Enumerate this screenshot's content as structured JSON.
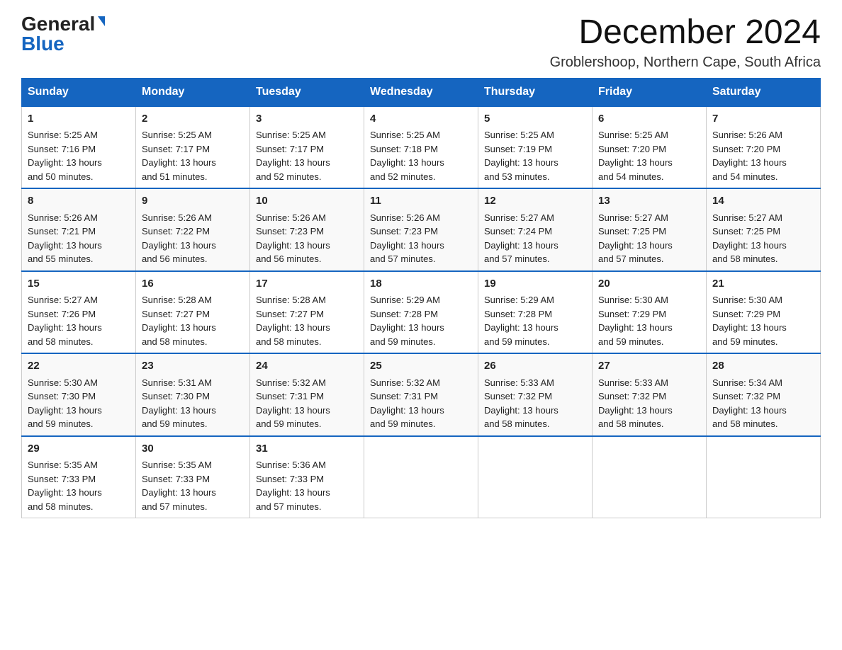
{
  "logo": {
    "general": "General",
    "blue": "Blue"
  },
  "title": "December 2024",
  "subtitle": "Groblershoop, Northern Cape, South Africa",
  "days": [
    "Sunday",
    "Monday",
    "Tuesday",
    "Wednesday",
    "Thursday",
    "Friday",
    "Saturday"
  ],
  "weeks": [
    [
      {
        "date": "1",
        "sunrise": "5:25 AM",
        "sunset": "7:16 PM",
        "daylight": "13 hours and 50 minutes."
      },
      {
        "date": "2",
        "sunrise": "5:25 AM",
        "sunset": "7:17 PM",
        "daylight": "13 hours and 51 minutes."
      },
      {
        "date": "3",
        "sunrise": "5:25 AM",
        "sunset": "7:17 PM",
        "daylight": "13 hours and 52 minutes."
      },
      {
        "date": "4",
        "sunrise": "5:25 AM",
        "sunset": "7:18 PM",
        "daylight": "13 hours and 52 minutes."
      },
      {
        "date": "5",
        "sunrise": "5:25 AM",
        "sunset": "7:19 PM",
        "daylight": "13 hours and 53 minutes."
      },
      {
        "date": "6",
        "sunrise": "5:25 AM",
        "sunset": "7:20 PM",
        "daylight": "13 hours and 54 minutes."
      },
      {
        "date": "7",
        "sunrise": "5:26 AM",
        "sunset": "7:20 PM",
        "daylight": "13 hours and 54 minutes."
      }
    ],
    [
      {
        "date": "8",
        "sunrise": "5:26 AM",
        "sunset": "7:21 PM",
        "daylight": "13 hours and 55 minutes."
      },
      {
        "date": "9",
        "sunrise": "5:26 AM",
        "sunset": "7:22 PM",
        "daylight": "13 hours and 56 minutes."
      },
      {
        "date": "10",
        "sunrise": "5:26 AM",
        "sunset": "7:23 PM",
        "daylight": "13 hours and 56 minutes."
      },
      {
        "date": "11",
        "sunrise": "5:26 AM",
        "sunset": "7:23 PM",
        "daylight": "13 hours and 57 minutes."
      },
      {
        "date": "12",
        "sunrise": "5:27 AM",
        "sunset": "7:24 PM",
        "daylight": "13 hours and 57 minutes."
      },
      {
        "date": "13",
        "sunrise": "5:27 AM",
        "sunset": "7:25 PM",
        "daylight": "13 hours and 57 minutes."
      },
      {
        "date": "14",
        "sunrise": "5:27 AM",
        "sunset": "7:25 PM",
        "daylight": "13 hours and 58 minutes."
      }
    ],
    [
      {
        "date": "15",
        "sunrise": "5:27 AM",
        "sunset": "7:26 PM",
        "daylight": "13 hours and 58 minutes."
      },
      {
        "date": "16",
        "sunrise": "5:28 AM",
        "sunset": "7:27 PM",
        "daylight": "13 hours and 58 minutes."
      },
      {
        "date": "17",
        "sunrise": "5:28 AM",
        "sunset": "7:27 PM",
        "daylight": "13 hours and 58 minutes."
      },
      {
        "date": "18",
        "sunrise": "5:29 AM",
        "sunset": "7:28 PM",
        "daylight": "13 hours and 59 minutes."
      },
      {
        "date": "19",
        "sunrise": "5:29 AM",
        "sunset": "7:28 PM",
        "daylight": "13 hours and 59 minutes."
      },
      {
        "date": "20",
        "sunrise": "5:30 AM",
        "sunset": "7:29 PM",
        "daylight": "13 hours and 59 minutes."
      },
      {
        "date": "21",
        "sunrise": "5:30 AM",
        "sunset": "7:29 PM",
        "daylight": "13 hours and 59 minutes."
      }
    ],
    [
      {
        "date": "22",
        "sunrise": "5:30 AM",
        "sunset": "7:30 PM",
        "daylight": "13 hours and 59 minutes."
      },
      {
        "date": "23",
        "sunrise": "5:31 AM",
        "sunset": "7:30 PM",
        "daylight": "13 hours and 59 minutes."
      },
      {
        "date": "24",
        "sunrise": "5:32 AM",
        "sunset": "7:31 PM",
        "daylight": "13 hours and 59 minutes."
      },
      {
        "date": "25",
        "sunrise": "5:32 AM",
        "sunset": "7:31 PM",
        "daylight": "13 hours and 59 minutes."
      },
      {
        "date": "26",
        "sunrise": "5:33 AM",
        "sunset": "7:32 PM",
        "daylight": "13 hours and 58 minutes."
      },
      {
        "date": "27",
        "sunrise": "5:33 AM",
        "sunset": "7:32 PM",
        "daylight": "13 hours and 58 minutes."
      },
      {
        "date": "28",
        "sunrise": "5:34 AM",
        "sunset": "7:32 PM",
        "daylight": "13 hours and 58 minutes."
      }
    ],
    [
      {
        "date": "29",
        "sunrise": "5:35 AM",
        "sunset": "7:33 PM",
        "daylight": "13 hours and 58 minutes."
      },
      {
        "date": "30",
        "sunrise": "5:35 AM",
        "sunset": "7:33 PM",
        "daylight": "13 hours and 57 minutes."
      },
      {
        "date": "31",
        "sunrise": "5:36 AM",
        "sunset": "7:33 PM",
        "daylight": "13 hours and 57 minutes."
      },
      null,
      null,
      null,
      null
    ]
  ],
  "labels": {
    "sunrise": "Sunrise:",
    "sunset": "Sunset:",
    "daylight": "Daylight:"
  }
}
